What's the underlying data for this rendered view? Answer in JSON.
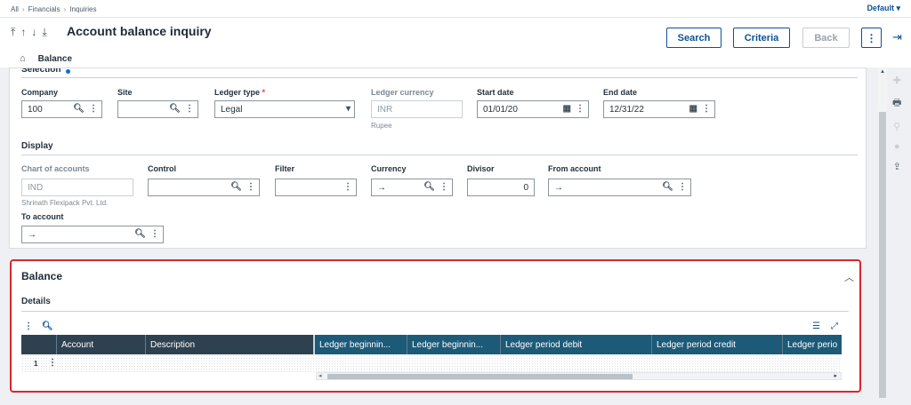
{
  "breadcrumb": [
    "All",
    "Financials",
    "Inquiries"
  ],
  "default_label": "Default",
  "header": {
    "title": "Account balance inquiry",
    "search_label": "Search",
    "criteria_label": "Criteria",
    "back_label": "Back",
    "tab_label": "Balance"
  },
  "selection": {
    "section_label": "Selection",
    "company": {
      "label": "Company",
      "value": "100"
    },
    "site": {
      "label": "Site",
      "value": ""
    },
    "ledger_type": {
      "label": "Ledger type",
      "required_mark": "*",
      "value": "Legal"
    },
    "ledger_currency": {
      "label": "Ledger currency",
      "value": "INR",
      "sub": "Rupee"
    },
    "start_date": {
      "label": "Start date",
      "value": "01/01/20"
    },
    "end_date": {
      "label": "End date",
      "value": "12/31/22"
    }
  },
  "display": {
    "section_label": "Display",
    "chart_of_accounts": {
      "label": "Chart of accounts",
      "value": "IND",
      "sub": "Shrinath Flexipack Pvt. Ltd."
    },
    "control": {
      "label": "Control",
      "value": ""
    },
    "filter": {
      "label": "Filter",
      "value": ""
    },
    "currency": {
      "label": "Currency",
      "value": "→"
    },
    "divisor": {
      "label": "Divisor",
      "value": "0"
    },
    "from_account": {
      "label": "From account",
      "value": "→"
    },
    "to_account": {
      "label": "To account",
      "value": "→"
    }
  },
  "balance": {
    "title": "Balance",
    "details_label": "Details",
    "columns_fixed": [
      "Account",
      "Description"
    ],
    "columns_scroll": [
      "Ledger beginnin...",
      "Ledger beginnin...",
      "Ledger period debit",
      "Ledger period credit",
      "Ledger perio"
    ],
    "rows": [
      {
        "num": "1"
      }
    ]
  },
  "icons": {
    "top_left_arrows": [
      "first-icon",
      "up-icon",
      "down-icon",
      "last-icon"
    ],
    "right_rail": [
      "add-icon",
      "print-icon",
      "attach-icon",
      "comment-icon",
      "share-icon"
    ]
  },
  "colors": {
    "accent": "#0b5394",
    "highlight_border": "#d9262e",
    "grid_header": "#1d5a78"
  }
}
